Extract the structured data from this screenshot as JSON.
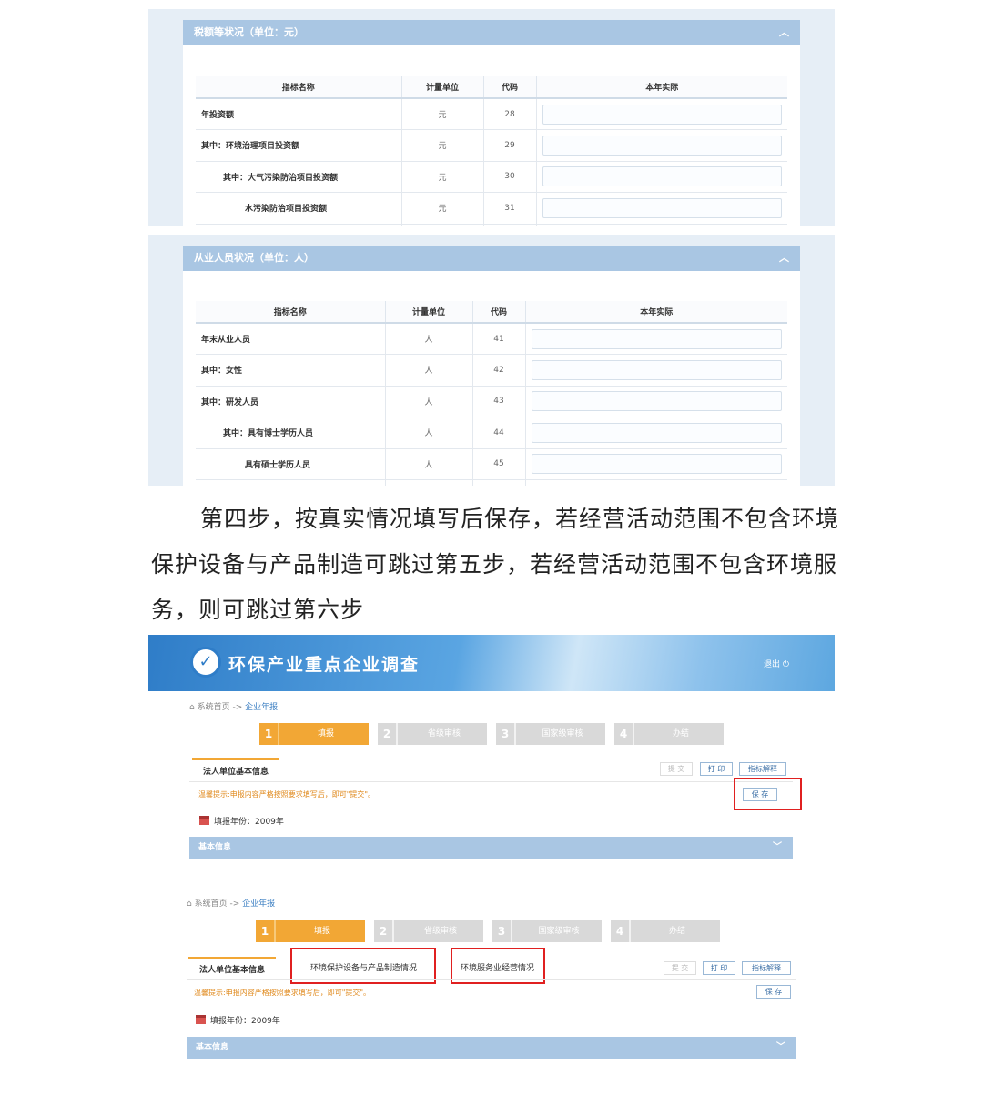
{
  "panel1": {
    "section_title": "税额等状况（单位：元）",
    "headers": [
      "指标名称",
      "计量单位",
      "代码",
      "本年实际"
    ],
    "rows": [
      {
        "name": "年投资额",
        "unit": "元",
        "code": "28"
      },
      {
        "name": "其中：环境治理项目投资额",
        "unit": "元",
        "code": "29"
      },
      {
        "name": "其中：大气污染防治项目投资额",
        "unit": "元",
        "code": "30"
      },
      {
        "name": "水污染防治项目投资额",
        "unit": "元",
        "code": "31"
      }
    ]
  },
  "panel2": {
    "section_title": "从业人员状况（单位：人）",
    "headers": [
      "指标名称",
      "计量单位",
      "代码",
      "本年实际"
    ],
    "rows": [
      {
        "name": "年末从业人员",
        "unit": "人",
        "code": "41"
      },
      {
        "name": "其中：女性",
        "unit": "人",
        "code": "42"
      },
      {
        "name": "其中：研发人员",
        "unit": "人",
        "code": "43"
      },
      {
        "name": "其中：具有博士学历人员",
        "unit": "人",
        "code": "44"
      },
      {
        "name": "具有硕士学历人员",
        "unit": "人",
        "code": "45"
      }
    ]
  },
  "paragraph": "第四步，按真实情况填写后保存，若经营活动范围不包含环境保护设备与产品制造可跳过第五步，若经营活动范围不包含环境服务，则可跳过第六步",
  "app": {
    "title": "环保产业重点企业调查",
    "logout": "退出",
    "breadcrumb": {
      "home": "系统首页",
      "sep": " -> ",
      "current": "企业年报"
    },
    "steps": [
      {
        "num": "1",
        "label": "填报"
      },
      {
        "num": "2",
        "label": "省级审核"
      },
      {
        "num": "3",
        "label": "国家级审核"
      },
      {
        "num": "4",
        "label": "办结"
      }
    ],
    "tab_basic": "法人单位基本信息",
    "tab_env_manufacturing": "环境保护设备与产品制造情况",
    "tab_env_service": "环境服务业经营情况",
    "buttons": {
      "submit": "提 交",
      "print": "打 印",
      "explain": "指标解释",
      "save": "保 存"
    },
    "tip": "温馨提示:申报内容严格按照要求填写后，即可\"提交\"。",
    "year_label": "填报年份：2009年",
    "basic_info_bar": "基本信息"
  }
}
